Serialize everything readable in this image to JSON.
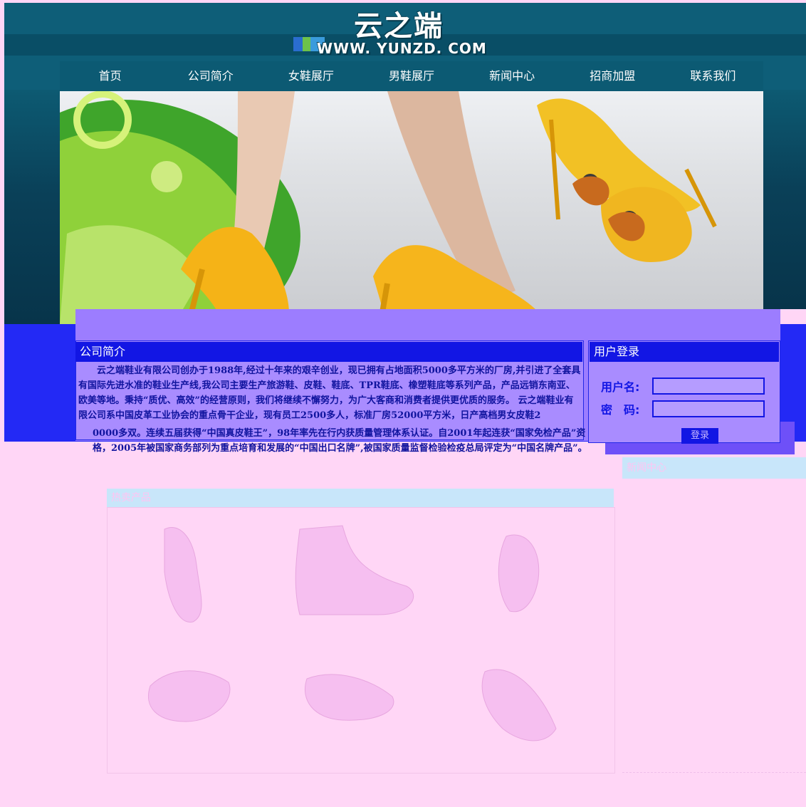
{
  "brand": {
    "logo_text": "云之端",
    "site_url": "WWW. YUNZD. COM"
  },
  "nav": {
    "items": [
      "首页",
      "公司简介",
      "女鞋展厅",
      "男鞋展厅",
      "新闻中心",
      "招商加盟",
      "联系我们"
    ]
  },
  "about": {
    "title": "公司简介",
    "text": "云之端鞋业有限公司创办于1988年,经过十年来的艰辛创业，现已拥有占地面积5000多平方米的厂房,并引进了全套具有国际先进水准的鞋业生产线,我公司主要生产旅游鞋、皮鞋、鞋底、TPR鞋底、橡塑鞋底等系列产品，产品远销东南亚、欧美等地。秉持“质优、高效”的经营原则，我们将继续不懈努力，为广大客商和消费者提供更优质的服务。 云之端鞋业有限公司系中国皮革工业协会的重点骨干企业，现有员工2500多人，标准厂房52000平方米，日产高档男女皮鞋2",
    "text2": "0000多双。连续五届获得“中国真皮鞋王”，98年率先在行内获质量管理体系认证。自2001年起连获“国家免检产品”资格，2005年被国家商务部列为重点培育和发展的“中国出口名牌”,被国家质量监督检验检疫总局评定为“中国名牌产品”。云之端"
  },
  "login": {
    "title": "用户登录",
    "username_label": "用户名:",
    "password_label": "密　码:",
    "button_label": "登录"
  },
  "products": {
    "title": "热卖产品"
  },
  "news": {
    "title": "新闻中心"
  },
  "colors": {
    "header": "#0e5e78",
    "nav": "#0c5a73",
    "mid_blue": "#2329f5",
    "mid_purple": "#9c7dff",
    "title_blue": "#1216e4",
    "bottom_pink": "#ffd6f6",
    "pink_title": "#c8e6fa"
  }
}
